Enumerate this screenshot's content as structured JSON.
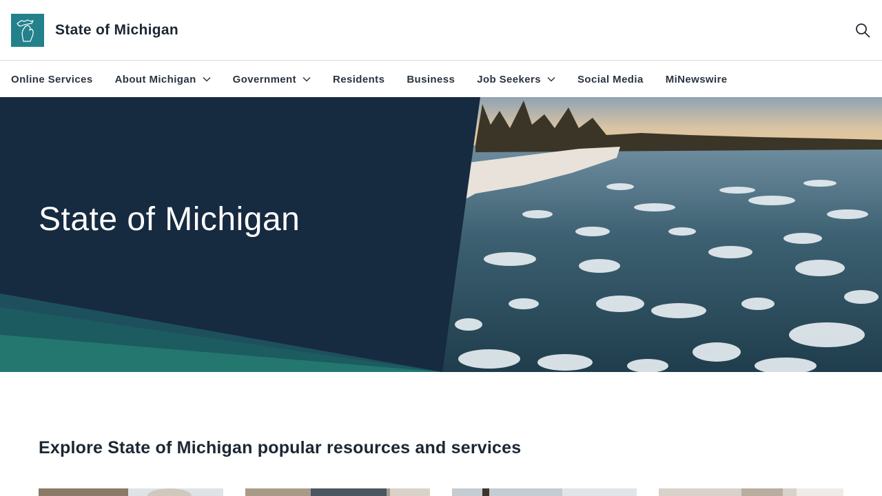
{
  "header": {
    "site_name": "State of Michigan",
    "logo_icon": "michigan-map-icon",
    "search_icon": "search-icon",
    "brand_color": "#23818c"
  },
  "nav": {
    "items": [
      {
        "label": "Online Services",
        "has_dropdown": false
      },
      {
        "label": "About Michigan",
        "has_dropdown": true
      },
      {
        "label": "Government",
        "has_dropdown": true
      },
      {
        "label": "Residents",
        "has_dropdown": false
      },
      {
        "label": "Business",
        "has_dropdown": false
      },
      {
        "label": "Job Seekers",
        "has_dropdown": true
      },
      {
        "label": "Social Media",
        "has_dropdown": false
      },
      {
        "label": "MiNewswire",
        "has_dropdown": false
      }
    ]
  },
  "hero": {
    "title": "State of Michigan",
    "panel_color": "#162a40",
    "accent_color": "#23818c"
  },
  "resources": {
    "heading": "Explore State of Michigan popular resources and services"
  }
}
